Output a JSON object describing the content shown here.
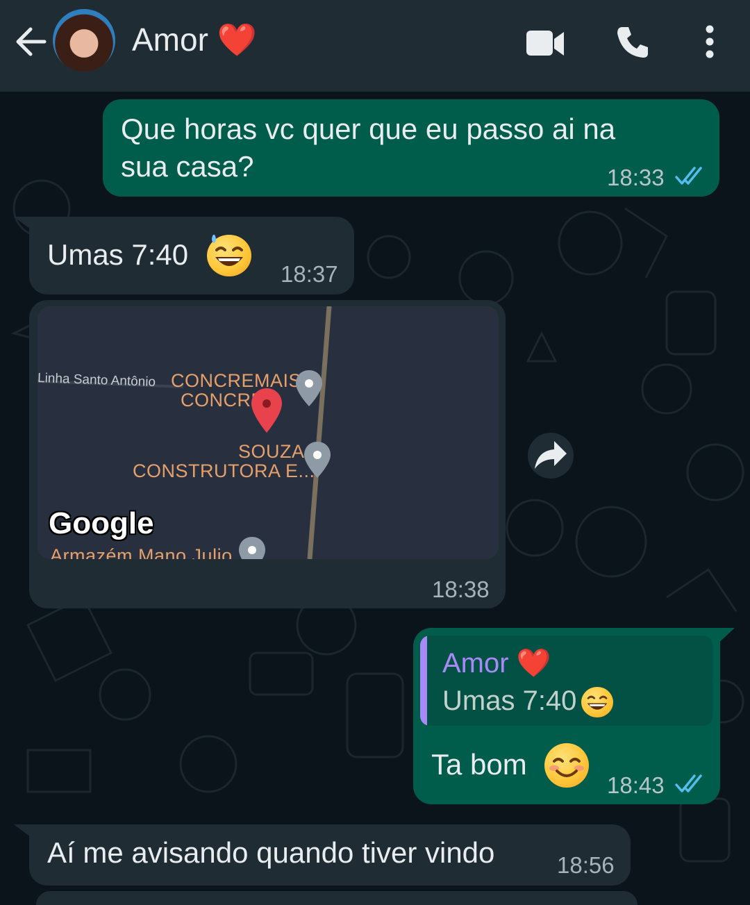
{
  "header": {
    "contact_name": "Amor ❤️"
  },
  "messages": [
    {
      "direction": "out",
      "text": "Que horas vc quer que eu passo ai na",
      "text2": "sua casa?",
      "time": "18:33",
      "status": "read"
    },
    {
      "direction": "in",
      "text": "Umas 7:40",
      "emoji": "sweat-smile",
      "time": "18:37"
    },
    {
      "direction": "in",
      "type": "location",
      "time": "18:38",
      "map": {
        "street": "Linha Santo Antônio",
        "places": [
          "CONCREMAIS",
          "CONCRE...",
          "SOUZA",
          "CONSTRUTORA E...",
          "Armazém Mano Julio"
        ],
        "attribution": "Google"
      }
    },
    {
      "direction": "out",
      "quote": {
        "author": "Amor ❤️",
        "text": "Umas 7:40"
      },
      "text": "Ta bom",
      "emoji": "smiling-face",
      "time": "18:43",
      "status": "read"
    },
    {
      "direction": "in",
      "text": "Aí me avisando quando tiver vindo",
      "time": "18:56"
    }
  ],
  "colors": {
    "background": "#0b141a",
    "header": "#1f2c34",
    "outgoing_bubble": "#005c4b",
    "incoming_bubble": "#1f2c34",
    "read_tick": "#53bdeb",
    "quote_accent": "#a88af7",
    "map_label": "#e6a06a"
  }
}
